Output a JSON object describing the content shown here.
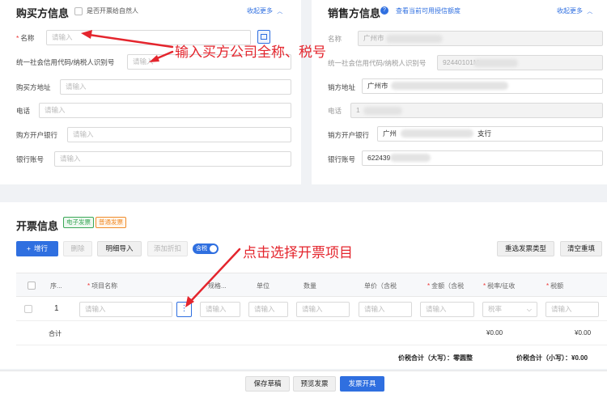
{
  "buyer": {
    "title": "购买方信息",
    "natural_person_label": "是否开票给自然人",
    "collapse": "收起更多",
    "fields": [
      {
        "label": "名称",
        "placeholder": "请输入",
        "required": true
      },
      {
        "label": "统一社会信用代码/纳税人识别号",
        "placeholder": "请输入"
      },
      {
        "label": "购买方地址",
        "placeholder": "请输入"
      },
      {
        "label": "电话",
        "placeholder": "请输入"
      },
      {
        "label": "购方开户银行",
        "placeholder": "请输入"
      },
      {
        "label": "银行账号",
        "placeholder": "请输入"
      }
    ]
  },
  "seller": {
    "title": "销售方信息",
    "credit_link": "查看当前可用授信额度",
    "collapse": "收起更多",
    "fields": [
      {
        "label": "名称",
        "value": "广州市"
      },
      {
        "label": "统一社会信用代码/纳税人识别号",
        "value": "92440101M"
      },
      {
        "label": "销方地址",
        "value": "广州市"
      },
      {
        "label": "电话",
        "value": "1"
      },
      {
        "label": "销方开户银行",
        "value": "广州",
        "suffix": "支行"
      },
      {
        "label": "银行账号",
        "value": "622439"
      }
    ]
  },
  "invoice": {
    "title": "开票信息",
    "tag_electronic": "电子发票",
    "tag_normal": "普通发票",
    "toolbar": {
      "add_row": "增行",
      "delete": "删除",
      "import_detail": "明细导入",
      "add_discount": "添加折扣",
      "tax_included": "含税",
      "reselect_type": "重选发票类型",
      "clear_all": "清空重填"
    },
    "columns": [
      "序...",
      "项目名称",
      "规格...",
      "单位",
      "数量",
      "单价（含税",
      "金额（含税",
      "税率/征收",
      "税额"
    ],
    "row": {
      "index": "1",
      "placeholder": "请输入",
      "tax_rate_placeholder": "税率"
    },
    "total_label": "合计",
    "total_amount": "¥0.00",
    "total_tax": "¥0.00",
    "grand_upper_label": "价税合计（大写）：",
    "grand_upper_value": "零圆整",
    "grand_lower_label": "价税合计（小写）：",
    "grand_lower_value": "¥0.00"
  },
  "footer": {
    "save_draft": "保存草稿",
    "preview": "预览发票",
    "issue": "发票开具"
  },
  "annotations": {
    "buyer_note": "输入买方公司全称、税号",
    "item_note": "点击选择开票项目"
  },
  "colors": {
    "primary": "#2f6fe0",
    "annotation": "#e4252d",
    "required": "#e33333",
    "tag_green": "#3aa757",
    "tag_orange": "#f08c2a"
  }
}
